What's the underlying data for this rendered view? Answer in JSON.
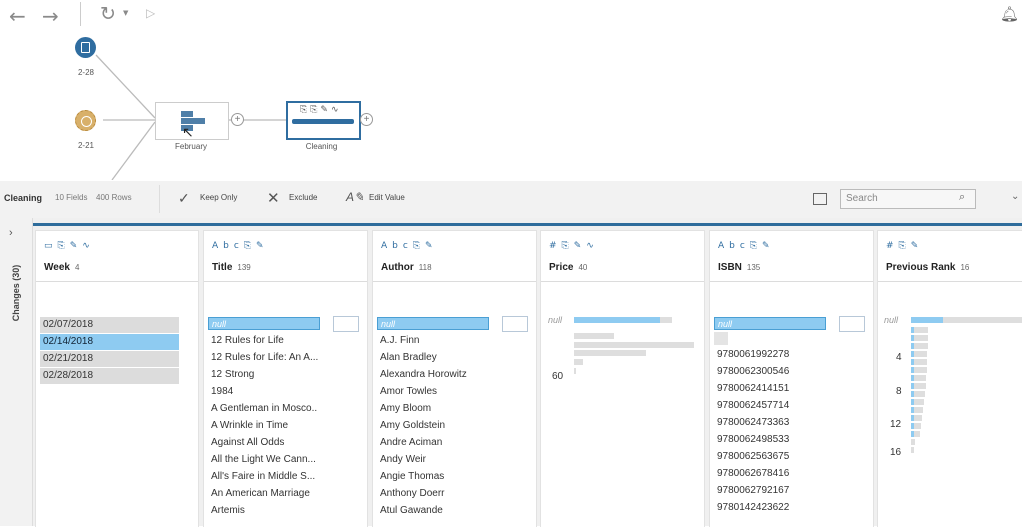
{
  "toolbar": {
    "back": "back-icon",
    "forward": "forward-icon",
    "refresh": "refresh-icon",
    "run": "run-icon",
    "notifications": "bell-icon"
  },
  "flow": {
    "inputs": [
      {
        "label": "2-28"
      },
      {
        "label": "2-21"
      }
    ],
    "union": {
      "label": "February"
    },
    "clean": {
      "label": "Cleaning"
    }
  },
  "profile": {
    "step_name": "Cleaning",
    "fields": "10 Fields",
    "rows": "400 Rows",
    "keep_only": "Keep Only",
    "exclude": "Exclude",
    "edit_value": "Edit Value",
    "search_placeholder": "Search"
  },
  "changes_label": "Changes (30)",
  "colors": {
    "accent": "#2f6d9c",
    "selected": "#8ecbf1",
    "bar": "#dcdcdc"
  },
  "columns": [
    {
      "name": "Week",
      "count": "4",
      "type": "date",
      "values": [
        "02/07/2018",
        "02/14/2018",
        "02/21/2018",
        "02/28/2018"
      ],
      "selected": "02/14/2018"
    },
    {
      "name": "Title",
      "count": "139",
      "type": "Abc",
      "values": [
        "null",
        "12 Rules for Life",
        "12 Rules for Life: An A...",
        "12 Strong",
        "1984",
        "A Gentleman in Mosco..",
        "A Wrinkle in Time",
        "Against All Odds",
        "All the Light We Cann...",
        "All's Faire in Middle S...",
        "An American Marriage",
        "Artemis"
      ]
    },
    {
      "name": "Author",
      "count": "118",
      "type": "Abc",
      "values": [
        "null",
        "A.J. Finn",
        "Alan Bradley",
        "Alexandra Horowitz",
        "Amor Towles",
        "Amy Bloom",
        "Amy Goldstein",
        "Andre Aciman",
        "Andy Weir",
        "Angie Thomas",
        "Anthony Doerr",
        "Atul Gawande"
      ]
    },
    {
      "name": "Price",
      "count": "40",
      "type": "#",
      "null_label": "null",
      "axis": [
        "60"
      ]
    },
    {
      "name": "ISBN",
      "count": "135",
      "type": "Abc",
      "values": [
        "null",
        "",
        "9780061992278",
        "9780062300546",
        "9780062414151",
        "9780062457714",
        "9780062473363",
        "9780062498533",
        "9780062563675",
        "9780062678416",
        "9780062792167",
        "9780142423622"
      ]
    },
    {
      "name": "Previous Rank",
      "count": "16",
      "type": "#",
      "null_label": "null",
      "axis": [
        "4",
        "8",
        "12",
        "16"
      ]
    }
  ]
}
